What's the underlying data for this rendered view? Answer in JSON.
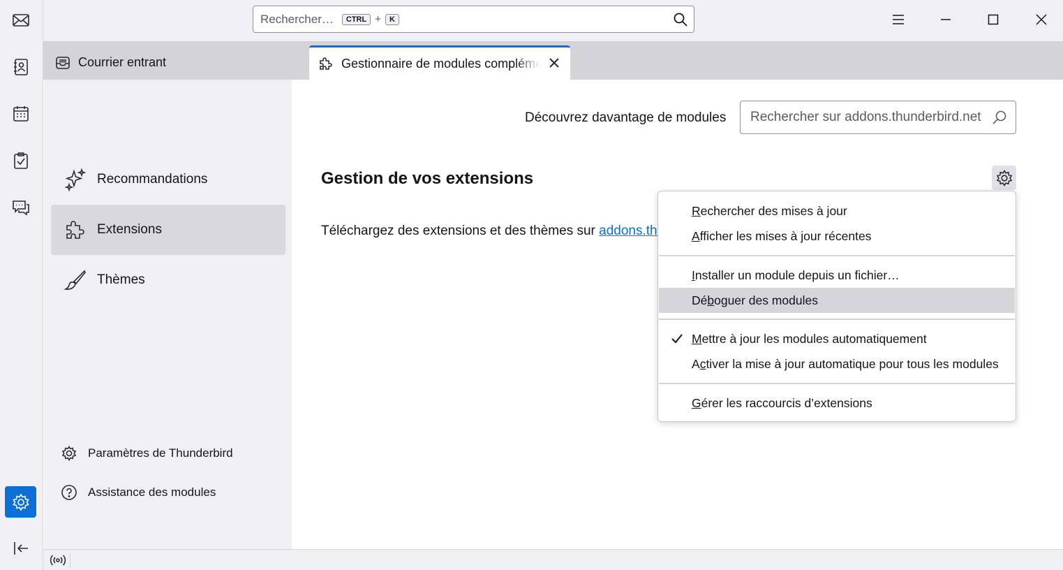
{
  "spaces": {
    "items": [
      {
        "name": "mail-icon"
      },
      {
        "name": "address-book-icon"
      },
      {
        "name": "calendar-icon"
      },
      {
        "name": "tasks-icon"
      },
      {
        "name": "chat-icon"
      }
    ],
    "settings_icon": "gear-icon",
    "collapse_icon": "collapse-sidebar-icon"
  },
  "titlebar": {
    "search_placeholder": "Rechercher…",
    "shortcut_key1": "CTRL",
    "shortcut_plus": "+",
    "shortcut_key2": "K"
  },
  "tabs": [
    {
      "label": "Courrier entrant"
    },
    {
      "label": "Gestionnaire de modules complémentaires"
    }
  ],
  "sidebar": {
    "categories": [
      {
        "label": "Recommandations"
      },
      {
        "label": "Extensions"
      },
      {
        "label": "Thèmes"
      }
    ],
    "footer": [
      {
        "label": "Paramètres de Thunderbird"
      },
      {
        "label": "Assistance des modules"
      }
    ]
  },
  "main": {
    "discover_label": "Découvrez davantage de modules",
    "amo_search_placeholder": "Rechercher sur addons.thunderbird.net",
    "heading": "Gestion de vos extensions",
    "description_text": "Téléchargez des extensions et des thèmes sur ",
    "description_link": "addons.thunderbird.net"
  },
  "menu": {
    "items": [
      {
        "accel": "R",
        "rest": "echercher des mises à jour"
      },
      {
        "accel": "A",
        "rest": "fficher les mises à jour récentes"
      },
      {
        "accel": "I",
        "rest": "nstaller un module depuis un fichier…"
      },
      {
        "pre": "Dé",
        "accel": "b",
        "rest": "oguer des modules"
      },
      {
        "accel": "M",
        "rest": "ettre à jour les modules automatiquement",
        "checked": true
      },
      {
        "pre": "A",
        "accel": "c",
        "rest": "tiver la mise à jour automatique pour tous les modules"
      },
      {
        "accel": "G",
        "rest": "érer les raccourcis d’extensions"
      }
    ]
  },
  "colors": {
    "accent": "#0b6fd6",
    "sidebar_bg": "#f0f0f4",
    "tabbar_bg": "#d4d4d8"
  }
}
